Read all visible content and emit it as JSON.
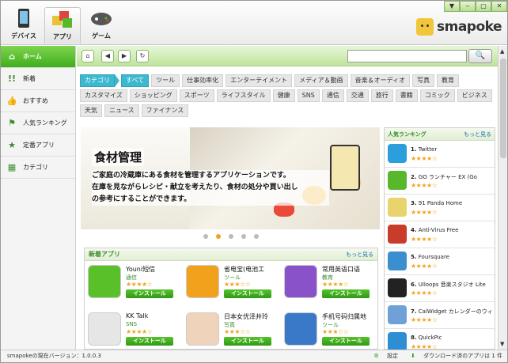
{
  "window": {
    "controls": [
      "▼",
      "‒",
      "▢",
      "✕"
    ]
  },
  "topnav": [
    {
      "label": "デバイス",
      "icon": "device-icon"
    },
    {
      "label": "アプリ",
      "icon": "apps-icon"
    },
    {
      "label": "ゲーム",
      "icon": "game-controller-icon"
    }
  ],
  "brand": {
    "name": "smapoke"
  },
  "sidebar": {
    "items": [
      {
        "label": "ホーム",
        "icon": "home-icon"
      },
      {
        "label": "新着",
        "icon": "new-icon"
      },
      {
        "label": "おすすめ",
        "icon": "thumbs-up-icon"
      },
      {
        "label": "人気ランキング",
        "icon": "flag-icon"
      },
      {
        "label": "定番アプリ",
        "icon": "star-icon"
      },
      {
        "label": "カテゴリ",
        "icon": "grid-icon"
      }
    ]
  },
  "toolbar": {
    "search_placeholder": "",
    "search_button": "🔍"
  },
  "categories": {
    "label": "カテゴリ",
    "rows": [
      [
        "すべて",
        "ツール",
        "仕事効率化",
        "エンターテイメント",
        "メディア＆動画",
        "音楽＆オーディオ",
        "写真",
        "教育"
      ],
      [
        "カスタマイズ",
        "ショッピング",
        "スポーツ",
        "ライフスタイル",
        "健康",
        "SNS",
        "通信",
        "交通",
        "旅行",
        "書籍",
        "コミック",
        "ビジネス"
      ],
      [
        "天気",
        "ニュース",
        "ファイナンス"
      ]
    ]
  },
  "banner": {
    "title": "食材管理",
    "lines": [
      "ご家庭の冷蔵庫にある食材を管理するアプリケーションです。",
      "在庫を見ながらレシピ・献立を考えたり、食材の処分や買い出し",
      "の参考にすることができます。"
    ]
  },
  "new_apps": {
    "title": "新着アプリ",
    "more": "もっと見る",
    "install_label": "インストール",
    "apps": [
      {
        "name": "Youni短信",
        "category": "通信",
        "stars": "★★★★☆",
        "color": "#5ac02a"
      },
      {
        "name": "省电宝(电池工",
        "category": "ツール",
        "stars": "★★★☆☆",
        "color": "#f2a11c"
      },
      {
        "name": "常用英语口语",
        "category": "教育",
        "stars": "★★★★☆",
        "color": "#8a52c9"
      },
      {
        "name": "KK Talk",
        "category": "SNS",
        "stars": "★★★★☆",
        "color": "#e6e6e6"
      },
      {
        "name": "日本女优泽井玲",
        "category": "写真",
        "stars": "★★★☆☆",
        "color": "#f0d3bb"
      },
      {
        "name": "手机号码归属地",
        "category": "ツール",
        "stars": "★★★☆☆",
        "color": "#3a78c8"
      }
    ]
  },
  "ranking": {
    "title": "人気ランキング",
    "more": "もっと見る",
    "items": [
      {
        "rank": "1.",
        "name": "Twitter",
        "stars": "★★★★☆",
        "color": "#2b9fdc"
      },
      {
        "rank": "2.",
        "name": "GO ランチャー EX (Go",
        "stars": "★★★★☆",
        "color": "#58b82c"
      },
      {
        "rank": "3.",
        "name": "91 Panda Home",
        "stars": "★★★★☆",
        "color": "#e9d36c"
      },
      {
        "rank": "4.",
        "name": "Anti-Virus Free",
        "stars": "★★★★☆",
        "color": "#c93b2a"
      },
      {
        "rank": "5.",
        "name": "Foursquare",
        "stars": "★★★★☆",
        "color": "#3b8fcf"
      },
      {
        "rank": "6.",
        "name": "Ulloops 音楽スタジオ Lite",
        "stars": "★★★★☆",
        "color": "#222222"
      },
      {
        "rank": "7.",
        "name": "CalWidget カレンダーのウィ",
        "stars": "★★★★☆",
        "color": "#6fa0d8"
      },
      {
        "rank": "8.",
        "name": "QuickPic",
        "stars": "★★★★☆",
        "color": "#2e8ed3"
      }
    ]
  },
  "status": {
    "version_label": "smapokeの現在バージョン：",
    "version": "1.0.0.3",
    "settings": "設定",
    "downloads": "ダウンロード済のアプリは 1 件"
  }
}
